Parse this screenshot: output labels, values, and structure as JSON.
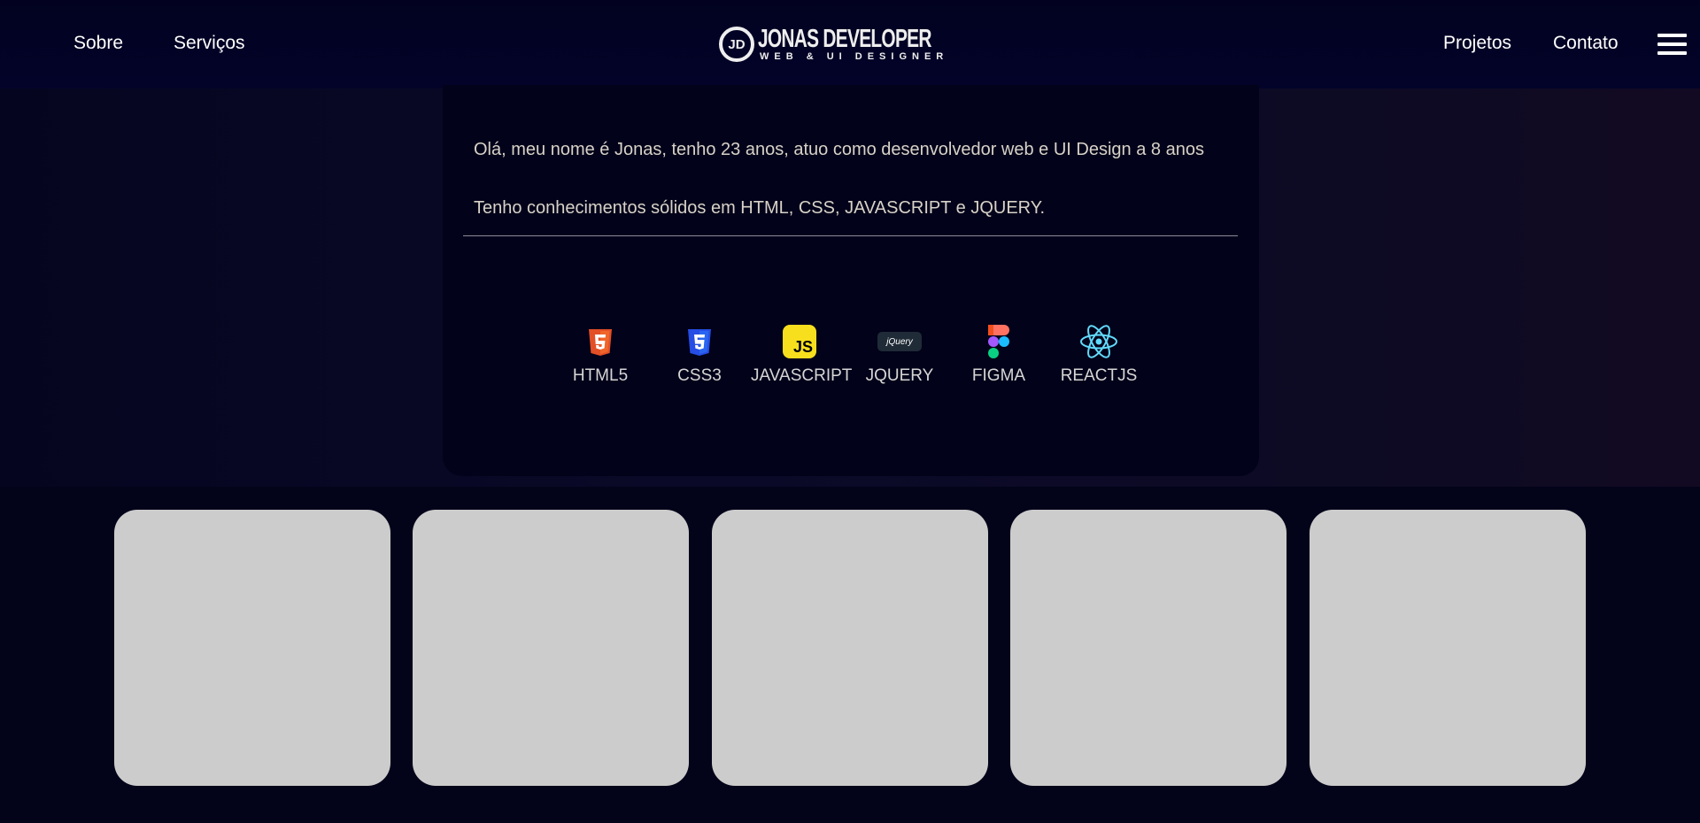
{
  "header": {
    "nav_left": [
      "Sobre",
      "Serviços"
    ],
    "nav_right": [
      "Projetos",
      "Contato"
    ],
    "logo": {
      "monogram": "JD",
      "title": "JONAS DEVELOPER",
      "subtitle": "WEB & UI DESIGNER"
    },
    "menu_icon": "hamburger-icon"
  },
  "about": {
    "paragraphs": [
      "Olá, meu nome é Jonas, tenho 23 anos, atuo como desenvolvedor web e UI Design a 8 anos",
      "Tenho conhecimentos sólidos em HTML, CSS, JAVASCRIPT e JQUERY."
    ],
    "skills": [
      {
        "label": "HTML5",
        "icon": "html5-icon",
        "color": "#e34f26"
      },
      {
        "label": "CSS3",
        "icon": "css3-icon",
        "color": "#264de4"
      },
      {
        "label": "JAVASCRIPT",
        "icon": "javascript-icon",
        "color": "#f7df1e"
      },
      {
        "label": "JQUERY",
        "icon": "jquery-icon",
        "color": "#1f2b36"
      },
      {
        "label": "FIGMA",
        "icon": "figma-icon",
        "color": "#f24e1e"
      },
      {
        "label": "REACTJS",
        "icon": "react-icon",
        "color": "#61dafb"
      }
    ]
  },
  "project_cards": 5
}
